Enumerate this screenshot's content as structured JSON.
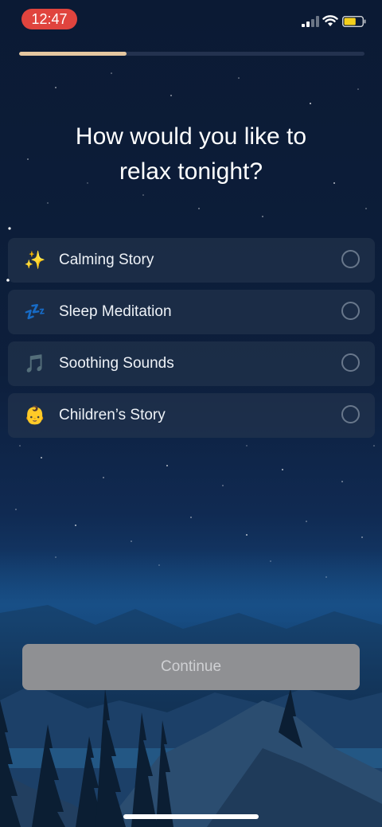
{
  "status_bar": {
    "time": "12:47",
    "signal_icon": "cellular-signal-icon",
    "wifi_icon": "wifi-icon",
    "battery_icon": "battery-icon",
    "battery_level": 0.65
  },
  "progress": {
    "value": 0.31
  },
  "question": {
    "line1": "How would you like to",
    "line2": "relax tonight?"
  },
  "options": [
    {
      "emoji": "✨",
      "icon": "sparkles-icon",
      "label": "Calming Story"
    },
    {
      "emoji": "💤",
      "icon": "zzz-sleep-icon",
      "label": "Sleep Meditation"
    },
    {
      "emoji": "🎵",
      "icon": "music-note-icon",
      "label": "Soothing Sounds"
    },
    {
      "emoji": "👶",
      "icon": "baby-face-icon",
      "label": "Children’s Story"
    }
  ],
  "continue_button": {
    "label": "Continue",
    "enabled": false
  },
  "colors": {
    "progress_fill": "#e4c7a0",
    "time_pill": "#e0443e",
    "button_disabled": "#8f9093"
  }
}
